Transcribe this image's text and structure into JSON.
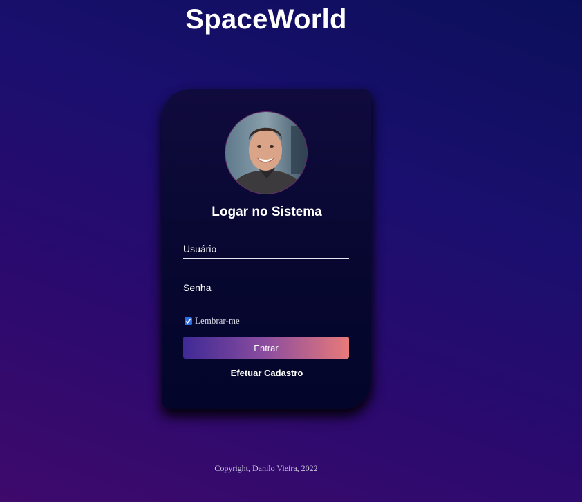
{
  "site": {
    "title": "SpaceWorld"
  },
  "login": {
    "heading": "Logar no Sistema",
    "username_placeholder": "Usuário",
    "password_placeholder": "Senha",
    "remember_label": "Lembrar-me",
    "remember_checked": true,
    "submit_label": "Entrar",
    "register_label": "Efetuar Cadastro"
  },
  "footer": {
    "copyright": "Copyright, Danilo Vieira, 2022"
  },
  "colors": {
    "button_gradient_start": "#3e2a96",
    "button_gradient_end": "#e87a7a",
    "checkbox_accent": "#2f6fe6"
  }
}
